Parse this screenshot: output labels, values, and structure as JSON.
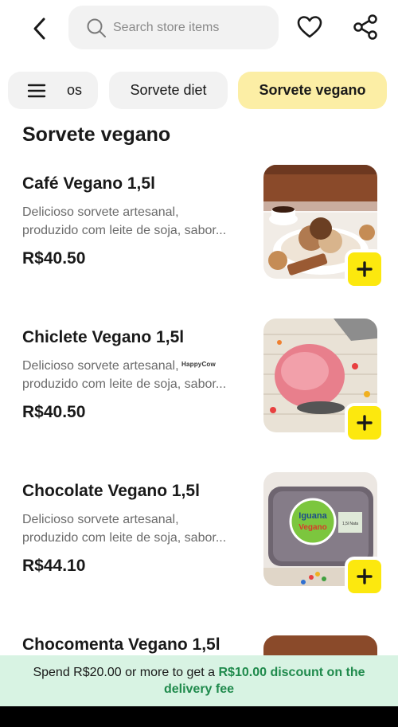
{
  "search": {
    "placeholder": "Search store items"
  },
  "categories": {
    "partial_label": "os",
    "items": [
      {
        "label": "Sorvete diet"
      },
      {
        "label": "Sorvete vegano",
        "active": true
      }
    ]
  },
  "section": {
    "title": "Sorvete vegano"
  },
  "products": [
    {
      "name": "Café Vegano 1,5l",
      "desc_line1": "Delicioso sorvete artesanal,",
      "desc_line2": "produzido com leite de soja, sabor...",
      "price": "R$40.50"
    },
    {
      "name": "Chiclete Vegano 1,5l",
      "desc_line1": "Delicioso sorvete artesanal,",
      "desc_line2": "produzido com leite de soja, sabor...",
      "price": "R$40.50"
    },
    {
      "name": "Chocolate Vegano 1,5l",
      "desc_line1": "Delicioso sorvete artesanal,",
      "desc_line2": "produzido com leite de soja, sabor...",
      "price": "R$44.10"
    },
    {
      "name": "Chocomenta Vegano 1,5l"
    }
  ],
  "product_image_labels": {
    "iguana_line1": "Iguana",
    "iguana_line2": "Vegano",
    "size": "1,5l Nata"
  },
  "watermark": "HappyCow",
  "banner": {
    "text_before": "Spend R$20.00 or more to get a ",
    "highlight": "R$10.00 discount on the delivery fee"
  },
  "icons": {
    "back": "chevron-left-icon",
    "search": "search-icon",
    "favorite": "heart-icon",
    "share": "share-icon",
    "menu": "menu-icon",
    "add": "plus-icon"
  },
  "colors": {
    "accent_yellow": "#fce80e",
    "chip_active": "#fceea5",
    "banner_bg": "#d8f3e3",
    "banner_highlight": "#1f8a4c"
  }
}
